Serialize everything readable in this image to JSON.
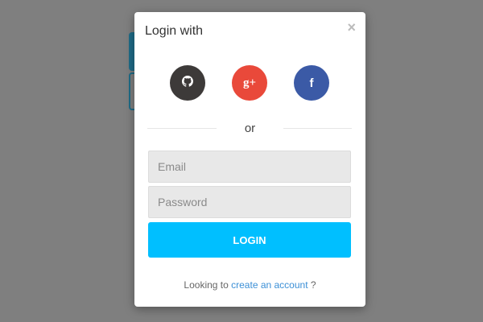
{
  "modal": {
    "title": "Login with",
    "close_label": "×"
  },
  "social": [
    {
      "name": "github",
      "icon": "github-icon",
      "color": "#3d3a39"
    },
    {
      "name": "google-plus",
      "icon": "google-plus-icon",
      "label": "g+",
      "color": "#e9493a"
    },
    {
      "name": "facebook",
      "icon": "facebook-icon",
      "label": "f",
      "color": "#3b5aa6"
    }
  ],
  "divider": {
    "text": "or"
  },
  "form": {
    "email_placeholder": "Email",
    "password_placeholder": "Password",
    "login_label": "LOGIN",
    "login_color": "#00bfff"
  },
  "footer": {
    "prefix": "Looking to ",
    "link_text": "create an account",
    "suffix": " ?",
    "link_color": "#3b8fd6"
  },
  "colors": {
    "overlay": "#7f7f7f",
    "background_button": "#1f6b87"
  }
}
